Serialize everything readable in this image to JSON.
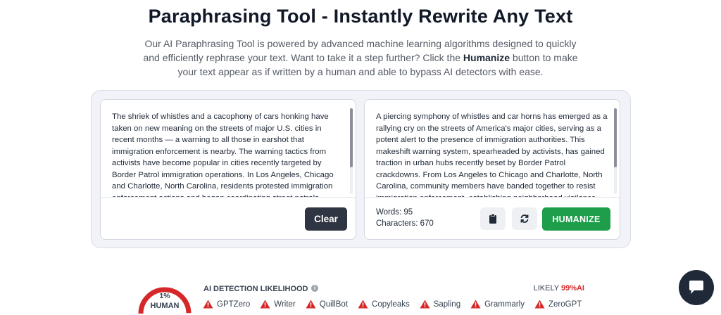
{
  "page": {
    "title": "Paraphrasing Tool - Instantly Rewrite Any Text",
    "intro_before": "Our AI Paraphrasing Tool is powered by advanced machine learning algorithms designed to quickly and efficiently rephrase your text. Want to take it a step further? Click the ",
    "intro_bold": "Humanize",
    "intro_after": " button to make your text appear as if written by a human and able to bypass AI detectors with ease."
  },
  "input": {
    "text": "The shriek of whistles and a cacophony of cars honking have taken on new meaning on the streets of major U.S. cities in recent months — a warning to all those in earshot that immigration enforcement is nearby. The warning tactics from activists have become popular in cities recently targeted by Border Patrol immigration operations. In Los Angeles, Chicago and Charlotte, North Carolina, residents protested immigration enforcement actions and began coordinating street patrols",
    "clear_label": "Clear"
  },
  "output": {
    "text": "A piercing symphony of whistles and car horns has emerged as a rallying cry on the streets of America's major cities, serving as a potent alert to the presence of immigration authorities. This makeshift warning system, spearheaded by activists, has gained traction in urban hubs recently beset by Border Patrol crackdowns. From Los Angeles to Chicago and Charlotte, North Carolina, community members have banded together to resist immigration enforcement, establishing neighborhood vigilance",
    "words": "Words: 95",
    "characters": "Characters: 670",
    "copy_icon": "clipboard-icon",
    "regenerate_icon": "refresh-icon",
    "humanize_label": "HUMANIZE"
  },
  "detection": {
    "gauge_value": "1%",
    "gauge_label": "HUMAN",
    "human_fraction": 0.01,
    "title": "AI DETECTION LIKELIHOOD",
    "likely_prefix": "LIKELY ",
    "likely_value": "99%AI",
    "detectors": [
      "GPTZero",
      "Writer",
      "QuillBot",
      "Copyleaks",
      "Sapling",
      "Grammarly",
      "ZeroGPT"
    ]
  },
  "colors": {
    "humanize": "#1e9e4a",
    "clear": "#2f3542",
    "warning": "#d62828",
    "accent_red": "#d62828"
  },
  "chat": {
    "icon": "chat-bubble-icon"
  }
}
